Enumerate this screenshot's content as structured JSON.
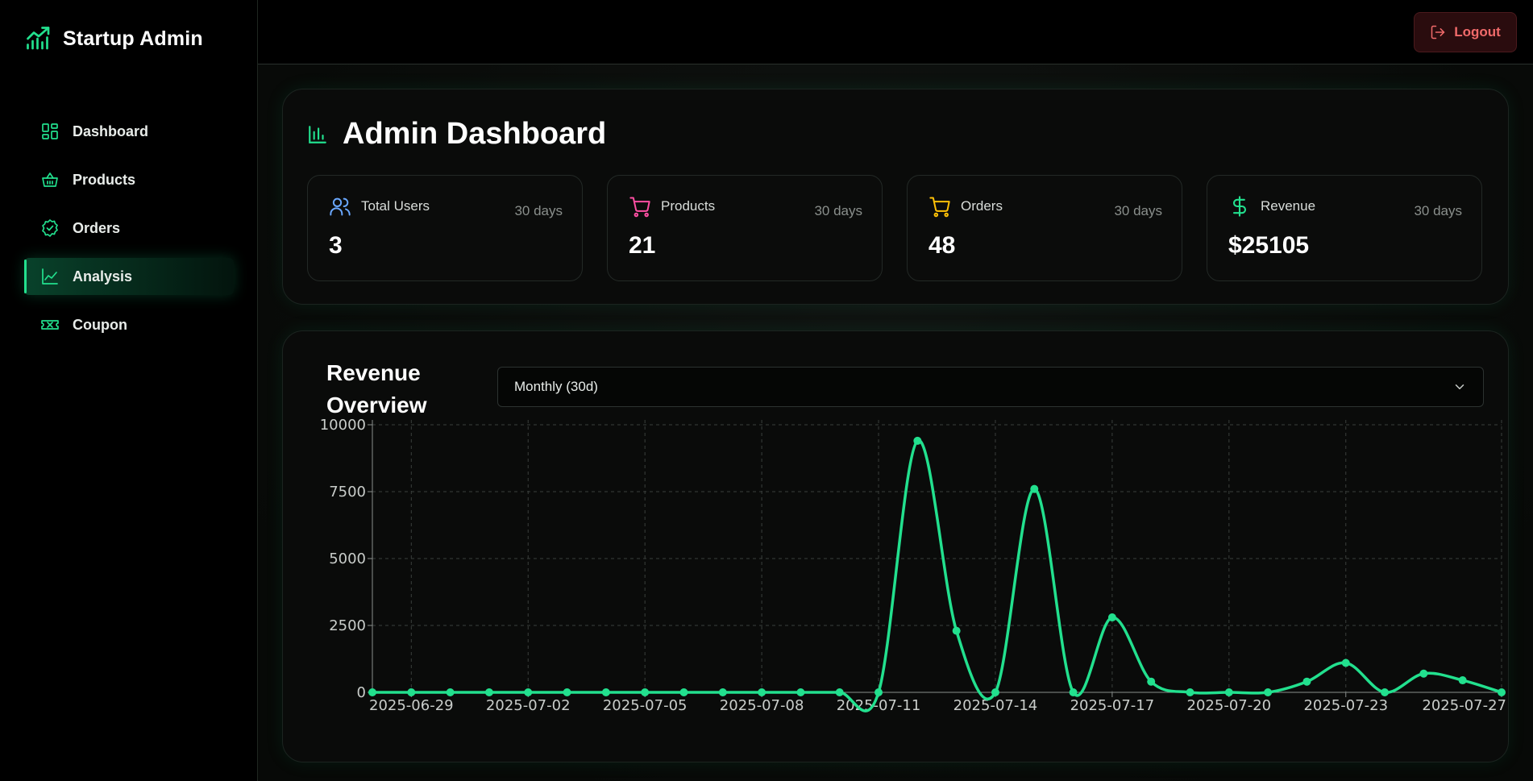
{
  "app": {
    "title": "Startup Admin"
  },
  "sidebar": {
    "items": [
      {
        "label": "Dashboard",
        "icon": "dashboard-icon",
        "active": false
      },
      {
        "label": "Products",
        "icon": "basket-icon",
        "active": false
      },
      {
        "label": "Orders",
        "icon": "check-badge-icon",
        "active": false
      },
      {
        "label": "Analysis",
        "icon": "line-chart-icon",
        "active": true
      },
      {
        "label": "Coupon",
        "icon": "ticket-icon",
        "active": false
      }
    ]
  },
  "header": {
    "logout_label": "Logout"
  },
  "dashboard": {
    "title": "Admin Dashboard",
    "stats": [
      {
        "label": "Total Users",
        "period": "30 days",
        "value": "3",
        "icon": "users-icon",
        "color": "#6aa8ff"
      },
      {
        "label": "Products",
        "period": "30 days",
        "value": "21",
        "icon": "cart-icon",
        "color": "#ff4fa3"
      },
      {
        "label": "Orders",
        "period": "30 days",
        "value": "48",
        "icon": "cart-icon",
        "color": "#ffc107"
      },
      {
        "label": "Revenue",
        "period": "30 days",
        "value": "$25105",
        "icon": "dollar-icon",
        "color": "#22e08e"
      }
    ]
  },
  "chart": {
    "title": "Revenue Overview",
    "range_select": {
      "selected": "Monthly (30d)"
    }
  },
  "colors": {
    "accent": "#22e08e",
    "logout": "#f06a6a"
  },
  "chart_data": {
    "type": "line",
    "title": "Revenue Overview",
    "xlabel": "",
    "ylabel": "",
    "ylim": [
      0,
      10000
    ],
    "y_ticks": [
      0,
      2500,
      5000,
      7500,
      10000
    ],
    "x_tick_labels": [
      "2025-06-29",
      "2025-07-02",
      "2025-07-05",
      "2025-07-08",
      "2025-07-11",
      "2025-07-14",
      "2025-07-17",
      "2025-07-20",
      "2025-07-23",
      "2025-07-27"
    ],
    "grid": true,
    "x": [
      "2025-06-28",
      "2025-06-29",
      "2025-06-30",
      "2025-07-01",
      "2025-07-02",
      "2025-07-03",
      "2025-07-04",
      "2025-07-05",
      "2025-07-06",
      "2025-07-07",
      "2025-07-08",
      "2025-07-09",
      "2025-07-10",
      "2025-07-11",
      "2025-07-12",
      "2025-07-13",
      "2025-07-14",
      "2025-07-15",
      "2025-07-16",
      "2025-07-17",
      "2025-07-18",
      "2025-07-19",
      "2025-07-20",
      "2025-07-21",
      "2025-07-22",
      "2025-07-23",
      "2025-07-24",
      "2025-07-25",
      "2025-07-26",
      "2025-07-27"
    ],
    "series": [
      {
        "color": "#22e08e",
        "values": [
          0,
          0,
          0,
          0,
          0,
          0,
          0,
          0,
          0,
          0,
          0,
          0,
          0,
          0,
          9400,
          2300,
          0,
          7600,
          0,
          2800,
          400,
          0,
          0,
          0,
          400,
          1100,
          0,
          700,
          450,
          0
        ]
      }
    ]
  }
}
